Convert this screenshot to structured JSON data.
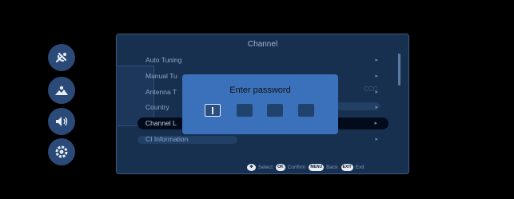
{
  "sidebar": {
    "icons": [
      {
        "name": "satellite-icon"
      },
      {
        "name": "picture-icon"
      },
      {
        "name": "sound-icon"
      },
      {
        "name": "settings-icon"
      }
    ]
  },
  "menu": {
    "title": "Channel",
    "items": [
      {
        "label": "Auto Tuning"
      },
      {
        "label": "Manual Tu"
      },
      {
        "label": "Antenna T"
      },
      {
        "label": "Country"
      },
      {
        "label": "Channel L"
      },
      {
        "label": "CI Information"
      }
    ],
    "selected_index": 4
  },
  "footer": {
    "hints": [
      {
        "key": "",
        "label": "Select"
      },
      {
        "key": "OK",
        "label": "Confirm"
      },
      {
        "key": "MENU",
        "label": "Back"
      },
      {
        "key": "EXIT",
        "label": "Exit"
      }
    ]
  },
  "dialog": {
    "title": "Enter password",
    "pin_length": 4,
    "active_index": 0
  },
  "colors": {
    "panel_bg": "#17304f",
    "dialog_bg": "#3b71bb",
    "icon_bg": "#2c4a78"
  }
}
